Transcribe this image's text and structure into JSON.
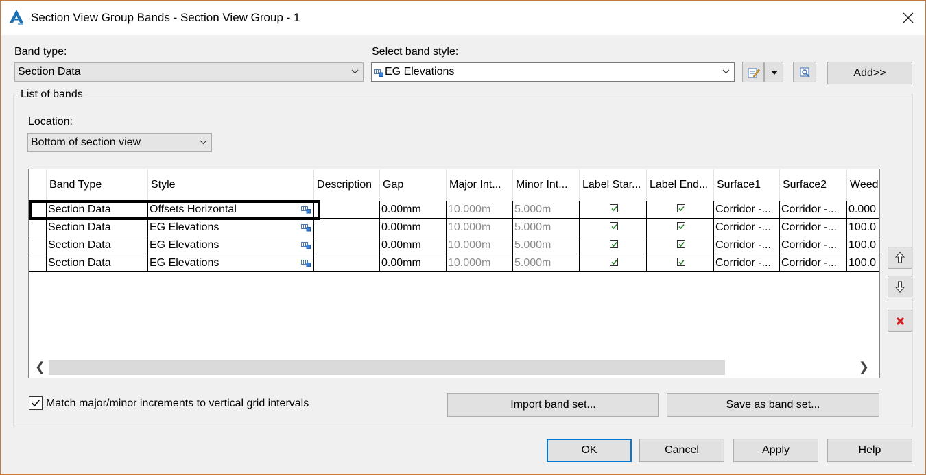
{
  "window": {
    "title": "Section View Group Bands - Section View Group - 1",
    "app_icon": "autocad-civil3d-icon",
    "close_icon": "close-icon"
  },
  "band_type": {
    "label": "Band type:",
    "value": "Section Data"
  },
  "band_style": {
    "label": "Select band style:",
    "value": "EG Elevations",
    "edit_icon": "edit-style-icon",
    "dropdown_icon": "chevron-down-icon",
    "preview_icon": "preview-icon",
    "add_label": "Add>>"
  },
  "list_of_bands": {
    "label": "List of bands",
    "location_label": "Location:",
    "location_value": "Bottom of section view",
    "columns": [
      "Band Type",
      "Style",
      "Description",
      "Gap",
      "Major Int...",
      "Minor Int...",
      "Label Star...",
      "Label End...",
      "Surface1",
      "Surface2",
      "Weed"
    ],
    "rows": [
      {
        "band_type": "Section Data",
        "style": "Offsets Horizontal",
        "description": "",
        "gap": "0.00mm",
        "major": "10.000m",
        "minor": "5.000m",
        "label_start": true,
        "label_end": true,
        "surface1": "Corridor -...",
        "surface2": "Corridor -...",
        "weed": "0.000"
      },
      {
        "band_type": "Section Data",
        "style": "EG Elevations",
        "description": "",
        "gap": "0.00mm",
        "major": "10.000m",
        "minor": "5.000m",
        "label_start": true,
        "label_end": true,
        "surface1": "Corridor -...",
        "surface2": "Corridor -...",
        "weed": "100.0"
      },
      {
        "band_type": "Section Data",
        "style": "EG Elevations",
        "description": "",
        "gap": "0.00mm",
        "major": "10.000m",
        "minor": "5.000m",
        "label_start": true,
        "label_end": true,
        "surface1": "Corridor -...",
        "surface2": "Corridor -...",
        "weed": "100.0"
      },
      {
        "band_type": "Section Data",
        "style": "EG Elevations",
        "description": "",
        "gap": "0.00mm",
        "major": "10.000m",
        "minor": "5.000m",
        "label_start": true,
        "label_end": true,
        "surface1": "Corridor -...",
        "surface2": "Corridor -...",
        "weed": "100.0"
      }
    ],
    "match_increments_label": "Match major/minor increments to vertical grid intervals",
    "match_increments_checked": true,
    "import_label": "Import band set...",
    "save_label": "Save as band set..."
  },
  "side_buttons": {
    "move_up_icon": "arrow-up-icon",
    "move_down_icon": "arrow-down-icon",
    "delete_icon": "delete-x-icon"
  },
  "footer": {
    "ok": "OK",
    "cancel": "Cancel",
    "apply": "Apply",
    "help": "Help"
  },
  "colors": {
    "accent": "#0078d7",
    "delete_red": "#d42020",
    "frame": "#c6793c"
  }
}
